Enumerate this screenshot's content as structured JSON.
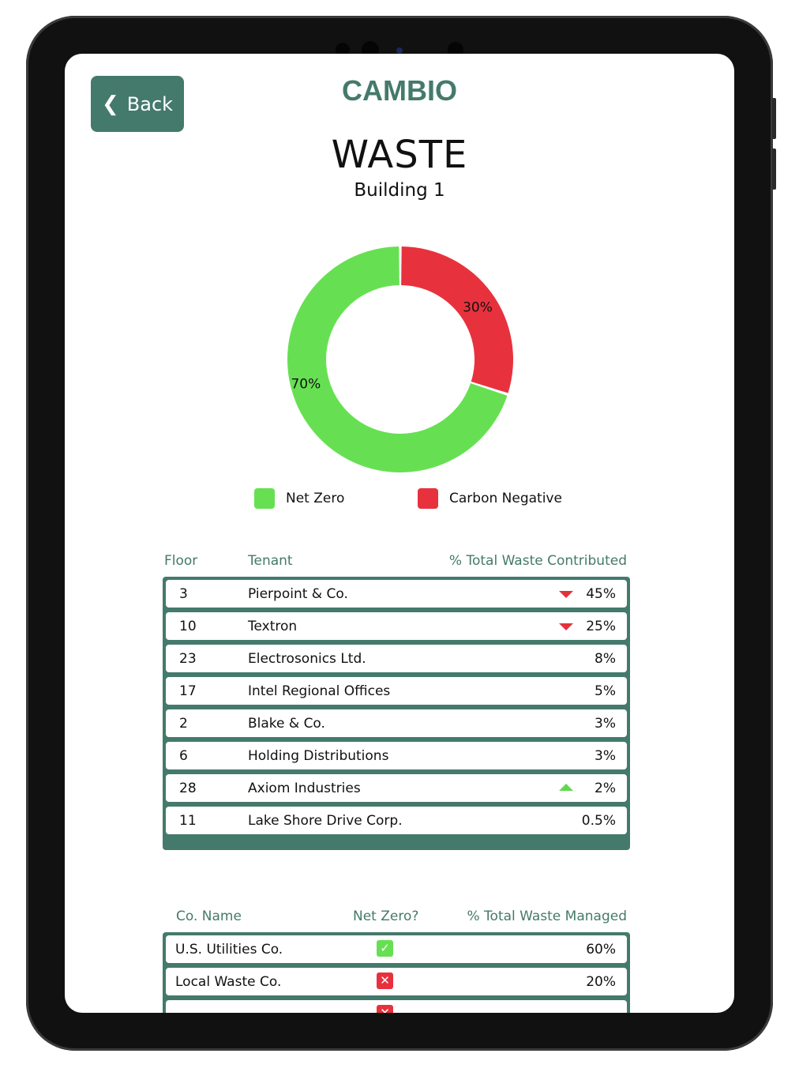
{
  "app": {
    "brand": "CAMBIO",
    "back_label": "Back"
  },
  "page": {
    "title": "WASTE",
    "subtitle": "Building 1"
  },
  "colors": {
    "accent": "#447a6b",
    "net_zero": "#66e052",
    "carbon_negative": "#e7323d"
  },
  "chart_data": {
    "type": "pie",
    "donut": true,
    "slices": [
      {
        "label": "Net Zero",
        "value": 70,
        "display": "70%",
        "color": "#66e052"
      },
      {
        "label": "Carbon Negative",
        "value": 30,
        "display": "30%",
        "color": "#e7323d"
      }
    ],
    "legend": [
      "Net Zero",
      "Carbon Negative"
    ],
    "legend_position": "bottom"
  },
  "tenants": {
    "headers": {
      "floor": "Floor",
      "tenant": "Tenant",
      "pct": "% Total Waste Contributed"
    },
    "rows": [
      {
        "floor": "3",
        "tenant": "Pierpoint & Co.",
        "pct": "45%",
        "trend": "down"
      },
      {
        "floor": "10",
        "tenant": "Textron",
        "pct": "25%",
        "trend": "down"
      },
      {
        "floor": "23",
        "tenant": "Electrosonics Ltd.",
        "pct": "8%",
        "trend": ""
      },
      {
        "floor": "17",
        "tenant": "Intel Regional Offices",
        "pct": "5%",
        "trend": ""
      },
      {
        "floor": "2",
        "tenant": "Blake & Co.",
        "pct": "3%",
        "trend": ""
      },
      {
        "floor": "6",
        "tenant": "Holding Distributions",
        "pct": "3%",
        "trend": ""
      },
      {
        "floor": "28",
        "tenant": "Axiom Industries",
        "pct": "2%",
        "trend": "up"
      },
      {
        "floor": "11",
        "tenant": "Lake Shore Drive Corp.",
        "pct": "0.5%",
        "trend": ""
      }
    ]
  },
  "companies": {
    "headers": {
      "name": "Co. Name",
      "net_zero": "Net Zero?",
      "pct": "% Total Waste Managed"
    },
    "rows": [
      {
        "name": "U.S. Utilities Co.",
        "net_zero": true,
        "pct": "60%"
      },
      {
        "name": "Local Waste Co.",
        "net_zero": false,
        "pct": "20%"
      },
      {
        "name": "",
        "net_zero": false,
        "pct": ""
      }
    ]
  }
}
